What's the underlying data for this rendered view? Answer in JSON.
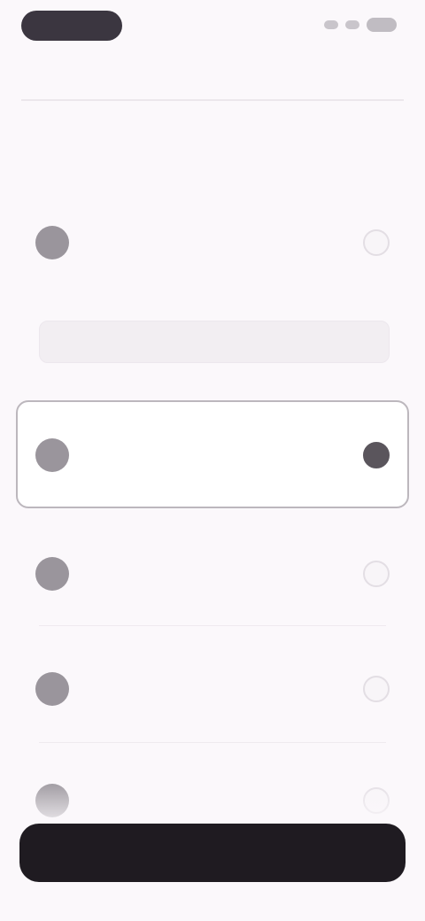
{
  "status_bar": {
    "time": "",
    "icons": [
      "signal-icon",
      "wifi-icon",
      "battery-icon"
    ]
  },
  "header": {
    "title": ""
  },
  "question": "",
  "options": [
    {
      "label": "",
      "icon": "option-icon",
      "selected": false
    },
    {
      "label": "",
      "icon": "option-icon",
      "selected": true
    },
    {
      "label": "",
      "icon": "option-icon",
      "selected": false
    },
    {
      "label": "",
      "icon": "option-icon",
      "selected": false
    },
    {
      "label": "",
      "icon": "option-icon",
      "selected": false
    }
  ],
  "details": {
    "subtitle": "",
    "input_placeholder": ""
  },
  "cta": {
    "label": ""
  },
  "colors": {
    "background": "#fbf8fb",
    "primary": "#1f1b21",
    "selected": "#5a555c"
  }
}
